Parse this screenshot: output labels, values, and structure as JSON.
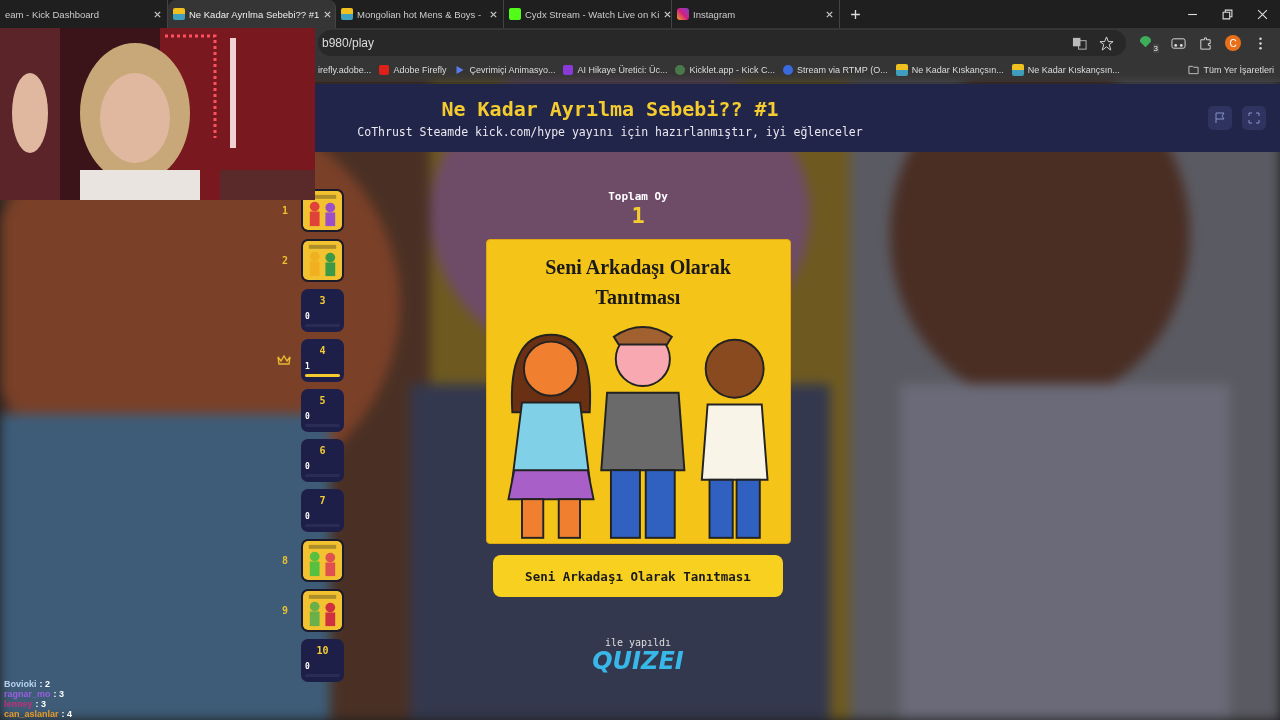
{
  "browser": {
    "tabs": [
      {
        "title": "eam - Kick Dashboard",
        "selected": false
      },
      {
        "title": "Ne Kadar Ayrılma Sebebi?? #1",
        "selected": true
      },
      {
        "title": "Mongolian hot Mens & Boys -",
        "selected": false
      },
      {
        "title": "Cydx Stream - Watch Live on Ki",
        "selected": false
      },
      {
        "title": "Instagram",
        "selected": false
      }
    ],
    "address": "b980/play",
    "extension_badge": "3",
    "profile_initial": "C",
    "bookmarks": [
      "irefly.adobe...",
      "Adobe Firefly",
      "Çevrimiçi Animasyo...",
      "AI Hikaye Üretici: Üc...",
      "Kicklet.app - Kick C...",
      "Stream via RTMP (O...",
      "Ne Kadar Kıskançsın...",
      "Ne Kadar Kıskançsın..."
    ],
    "all_bookmarks": "Tüm Yer İşaretleri"
  },
  "quiz": {
    "title": "Ne Kadar Ayrılma Sebebi?? #1",
    "subtitle": "CoThrust Steamde kick.com/hype yayını için hazırlanmıştır, iyi eğlenceler",
    "total_label": "Toplam Oy",
    "total": "1",
    "card_title": "Seni Arkadaşı Olarak Tanıtması",
    "answer": "Seni Arkadaşı Olarak Tanıtması",
    "made_with": "ile yapıldı",
    "brand": "QUIZEI",
    "options": [
      {
        "number": "1"
      },
      {
        "number": "2"
      },
      {
        "number": "3",
        "kind": "box",
        "votes": "0",
        "leader": false
      },
      {
        "number": "4",
        "kind": "box",
        "votes": "1",
        "level": 1,
        "leader": true
      },
      {
        "number": "5",
        "kind": "box",
        "votes": "0",
        "leader": false
      },
      {
        "number": "6",
        "kind": "box",
        "votes": "0",
        "leader": false
      },
      {
        "number": "7",
        "kind": "box",
        "votes": "0",
        "leader": false
      },
      {
        "number": "8"
      },
      {
        "number": "9"
      },
      {
        "number": "10",
        "kind": "box",
        "votes": "0",
        "leader": false
      }
    ]
  },
  "chat_overlay": [
    {
      "user": "Bovioki",
      "score": ": 2",
      "color": "#b8d0ee"
    },
    {
      "user": "ragnar_mo",
      "score": ": 3",
      "color": "#9a5ee0"
    },
    {
      "user": "lenney",
      "score": ": 3",
      "color": "#c0307a"
    },
    {
      "user": "can_aslanlar",
      "score": ": 4",
      "color": "#e89a2a"
    }
  ]
}
